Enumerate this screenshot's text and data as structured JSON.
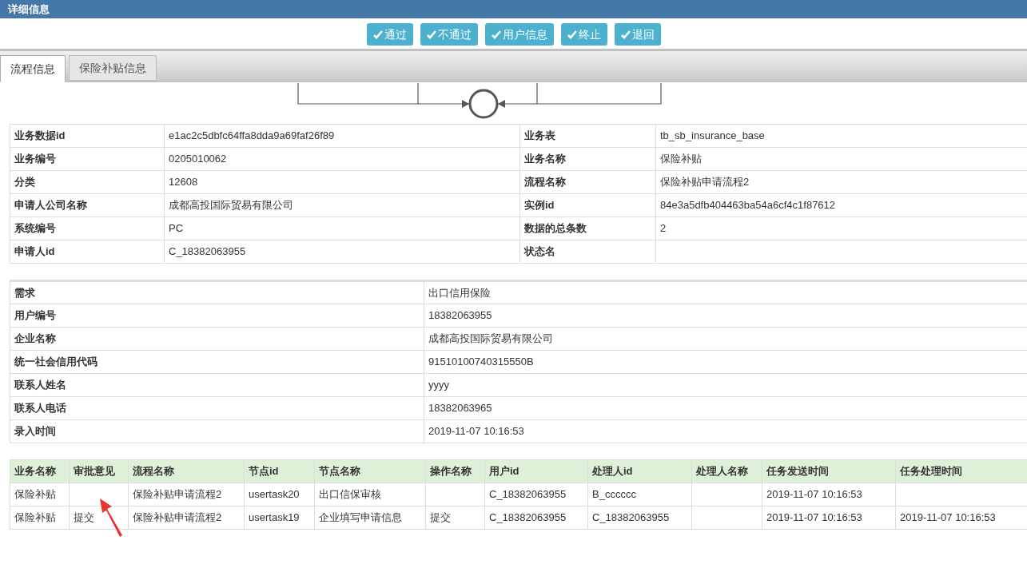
{
  "header": {
    "title": "详细信息"
  },
  "buttons": [
    {
      "label": "通过"
    },
    {
      "label": "不通过"
    },
    {
      "label": "用户信息"
    },
    {
      "label": "终止"
    },
    {
      "label": "退回"
    }
  ],
  "tabs": [
    {
      "label": "流程信息",
      "selected": true
    },
    {
      "label": "保险补贴信息",
      "selected": false
    }
  ],
  "info_table": [
    {
      "label_1": "业务数据id",
      "value_1": "e1ac2c5dbfc64ffa8dda9a69faf26f89",
      "label_2": "业务表",
      "value_2": "tb_sb_insurance_base"
    },
    {
      "label_1": "业务编号",
      "value_1": "0205010062",
      "label_2": "业务名称",
      "value_2": "保险补贴"
    },
    {
      "label_1": "分类",
      "value_1": "12608",
      "label_2": "流程名称",
      "value_2": "保险补贴申请流程2"
    },
    {
      "label_1": "申请人公司名称",
      "value_1": "成都高投国际贸易有限公司",
      "label_2": "实例id",
      "value_2": "84e3a5dfb404463ba54a6cf4c1f87612"
    },
    {
      "label_1": "系统编号",
      "value_1": "PC",
      "label_2": "数据的总条数",
      "value_2": "2"
    },
    {
      "label_1": "申请人id",
      "value_1": "C_18382063955",
      "label_2": "状态名"
    }
  ],
  "form_table": [
    {
      "label": "需求",
      "value": "出口信用保险"
    },
    {
      "label": "用户编号",
      "value": "18382063955"
    },
    {
      "label": "企业名称",
      "value": "成都高投国际贸易有限公司"
    },
    {
      "label": "统一社会信用代码",
      "value": "91510100740315550B"
    },
    {
      "label": "联系人姓名",
      "value": "yyyy"
    },
    {
      "label": "联系人电话",
      "value": "18382063965"
    },
    {
      "label": "录入时间",
      "value": "2019-11-07 10:16:53"
    }
  ],
  "history_table": {
    "columns": [
      "业务名称",
      "审批意见",
      "流程名称",
      "节点id",
      "节点名称",
      "操作名称",
      "用户id",
      "处理人id",
      "处理人名称",
      "任务发送时间",
      "任务处理时间"
    ],
    "rows": [
      {
        "business_name": "保险补贴",
        "process_name": "保险补贴申请流程2",
        "node_id": "usertask20",
        "node_name": "出口信保审核",
        "user_id": "C_18382063955",
        "handler_id": "B_cccccc",
        "send_time": "2019-11-07 10:16:53"
      },
      {
        "business_name": "保险补贴",
        "opinion": "提交",
        "process_name": "保险补贴申请流程2",
        "node_id": "usertask19",
        "node_name": "企业填写申请信息",
        "operation": "提交",
        "user_id": "C_18382063955",
        "handler_id": "C_18382063955",
        "send_time": "2019-11-07 10:16:53",
        "handle_time": "2019-11-07 10:16:53"
      }
    ]
  }
}
